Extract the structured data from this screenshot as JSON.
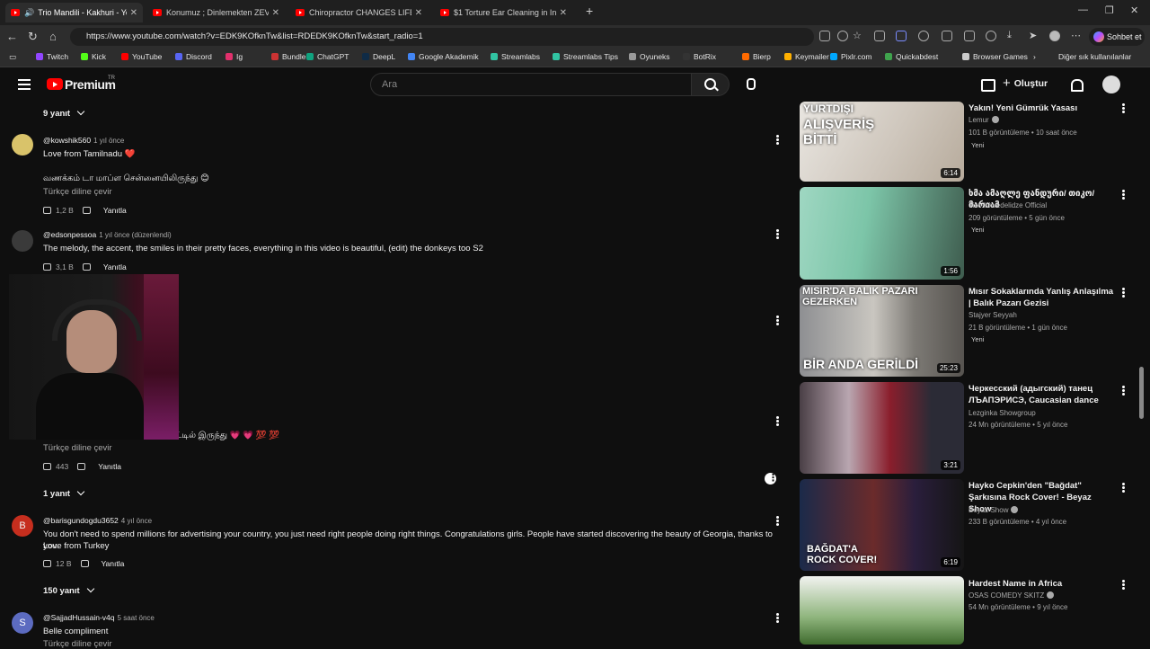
{
  "browser": {
    "tabs": [
      {
        "title": "Trio Mandili - Kakhuri - YouTube",
        "active": true
      },
      {
        "title": "Konumuz ; Dinlemekten ZEVK Alıp",
        "active": false
      },
      {
        "title": "Chiropractor CHANGES LIFE for TE",
        "active": false
      },
      {
        "title": "$1 Torture Ear Cleaning in India",
        "active": false
      }
    ],
    "new_tab": "+",
    "url": "https://www.youtube.com/watch?v=EDK9KOfknTw&list=RDEDK9KOfknTw&start_radio=1",
    "copilot_label": "Sohbet et",
    "bookmarks": [
      "Twitch",
      "Kick",
      "YouTube",
      "Discord",
      "Ig",
      "Bundle",
      "ChatGPT",
      "DeepL",
      "Google Akademik",
      "Streamlabs",
      "Streamlabs Tips",
      "Oyuneks",
      "BotRix",
      "Bierp",
      "Keymailer",
      "Pixlr.com",
      "Quickabdest",
      "Browser Games"
    ],
    "other_bookmarks": "Diğer sık kullanılanlar",
    "bookmark_colors": [
      "#9146ff",
      "#53fc18",
      "#ff0000",
      "#5865f2",
      "#e1306c",
      "#cc3333",
      "#10a37f",
      "#0f2b46",
      "#4285f4",
      "#31c3a2",
      "#31c3a2",
      "#999999",
      "#333333",
      "#ff6a00",
      "#ffb000",
      "#00a8ff",
      "#3fa34d",
      "#cccccc"
    ]
  },
  "youtube": {
    "logo_text": "Premium",
    "logo_badge": "TR",
    "search_placeholder": "Ara",
    "create_label": "Oluştur"
  },
  "comments": [
    {
      "type": "replies",
      "label": "9 yanıt"
    },
    {
      "author": "@kowshik560",
      "time": "1 yıl önce",
      "text": [
        "Love from Tamilnadu ❤️",
        "",
        "வணக்கம் டா மாப்ள சென்னையிலிருந்து 😊"
      ],
      "translate": "Türkçe diline çevir",
      "likes": "1,2 B",
      "reply": "Yanıtla"
    },
    {
      "author": "@edsonpessoa",
      "time": "1 yıl önce (düzenlendi)",
      "text": [
        "The melody, the accent, the smiles in their pretty faces, everything in this video is beautiful, (edit) the donkeys too S2"
      ],
      "likes": "3,1 B",
      "reply": "Yanıtla"
    },
    {
      "partial_text": "ட்டில் இருந்து 💗 💗 💯 💯",
      "translate": "Türkçe diline çevir",
      "likes": "443",
      "reply": "Yanıtla"
    },
    {
      "type": "replies",
      "label": "1 yanıt"
    },
    {
      "author": "@barisgundogdu3652",
      "avatar_letter": "B",
      "time": "4 yıl önce",
      "text": [
        "You don't need to spend millions for advertising your country, you just need right people doing right things. Congratulations girls. People have started discovering the beauty of Georgia, thanks to you.",
        "Love from Turkey"
      ],
      "likes": "12 B",
      "reply": "Yanıtla"
    },
    {
      "type": "replies",
      "label": "150 yanıt"
    },
    {
      "author": "@SajjadHussain-v4q",
      "avatar_letter": "S",
      "time": "5 saat önce",
      "text": [
        "Belle compliment"
      ],
      "translate": "Türkçe diline çevir"
    }
  ],
  "sidebar_videos": [
    {
      "title": "Yakın! Yeni Gümrük Yasası",
      "channel": "Lemur",
      "verified": true,
      "views": "101 B görüntüleme",
      "age": "10 saat önce",
      "badge": "Yeni",
      "duration": "6:14",
      "thumb_text": [
        "YURTDIŞI",
        "ALIŞVERİŞ",
        "BİTTİ"
      ]
    },
    {
      "title": "ხმა ამაღლე ფანდური/ თიკო/მარიამ",
      "channel": "Tiko Khvedelidze Official",
      "verified": false,
      "views": "209 görüntüleme",
      "age": "5 gün önce",
      "badge": "Yeni",
      "duration": "1:56"
    },
    {
      "title": "Mısır Sokaklarında Yanlış Anlaşılma | Balık Pazarı Gezisi",
      "channel": "Stajyer Seyyah",
      "verified": false,
      "views": "21 B görüntüleme",
      "age": "1 gün önce",
      "badge": "Yeni",
      "duration": "25:23",
      "thumb_text": [
        "MISIR'DA BALIK PAZARI GEZERKEN",
        "BİR ANDA GERİLDİ"
      ]
    },
    {
      "title": "Черкесский (адыгский) танец ЛЪАПЭРИСЭ, Caucasian dance",
      "channel": "Lezginka Showgroup",
      "verified": false,
      "views": "24 Mn görüntüleme",
      "age": "5 yıl önce",
      "duration": "3:21"
    },
    {
      "title": "Hayko Cepkin'den \"Bağdat\" Şarkısına Rock Cover! - Beyaz Show",
      "channel": "Beyaz Show",
      "verified": true,
      "views": "233 B görüntüleme",
      "age": "4 yıl önce",
      "duration": "6:19",
      "thumb_text": [
        "BAĞDAT'A",
        "ROCK COVER!"
      ]
    },
    {
      "title": "Hardest Name in Africa",
      "channel": "OSAS COMEDY SKITZ",
      "verified": true,
      "views": "54 Mn görüntüleme",
      "age": "9 yıl önce"
    }
  ]
}
